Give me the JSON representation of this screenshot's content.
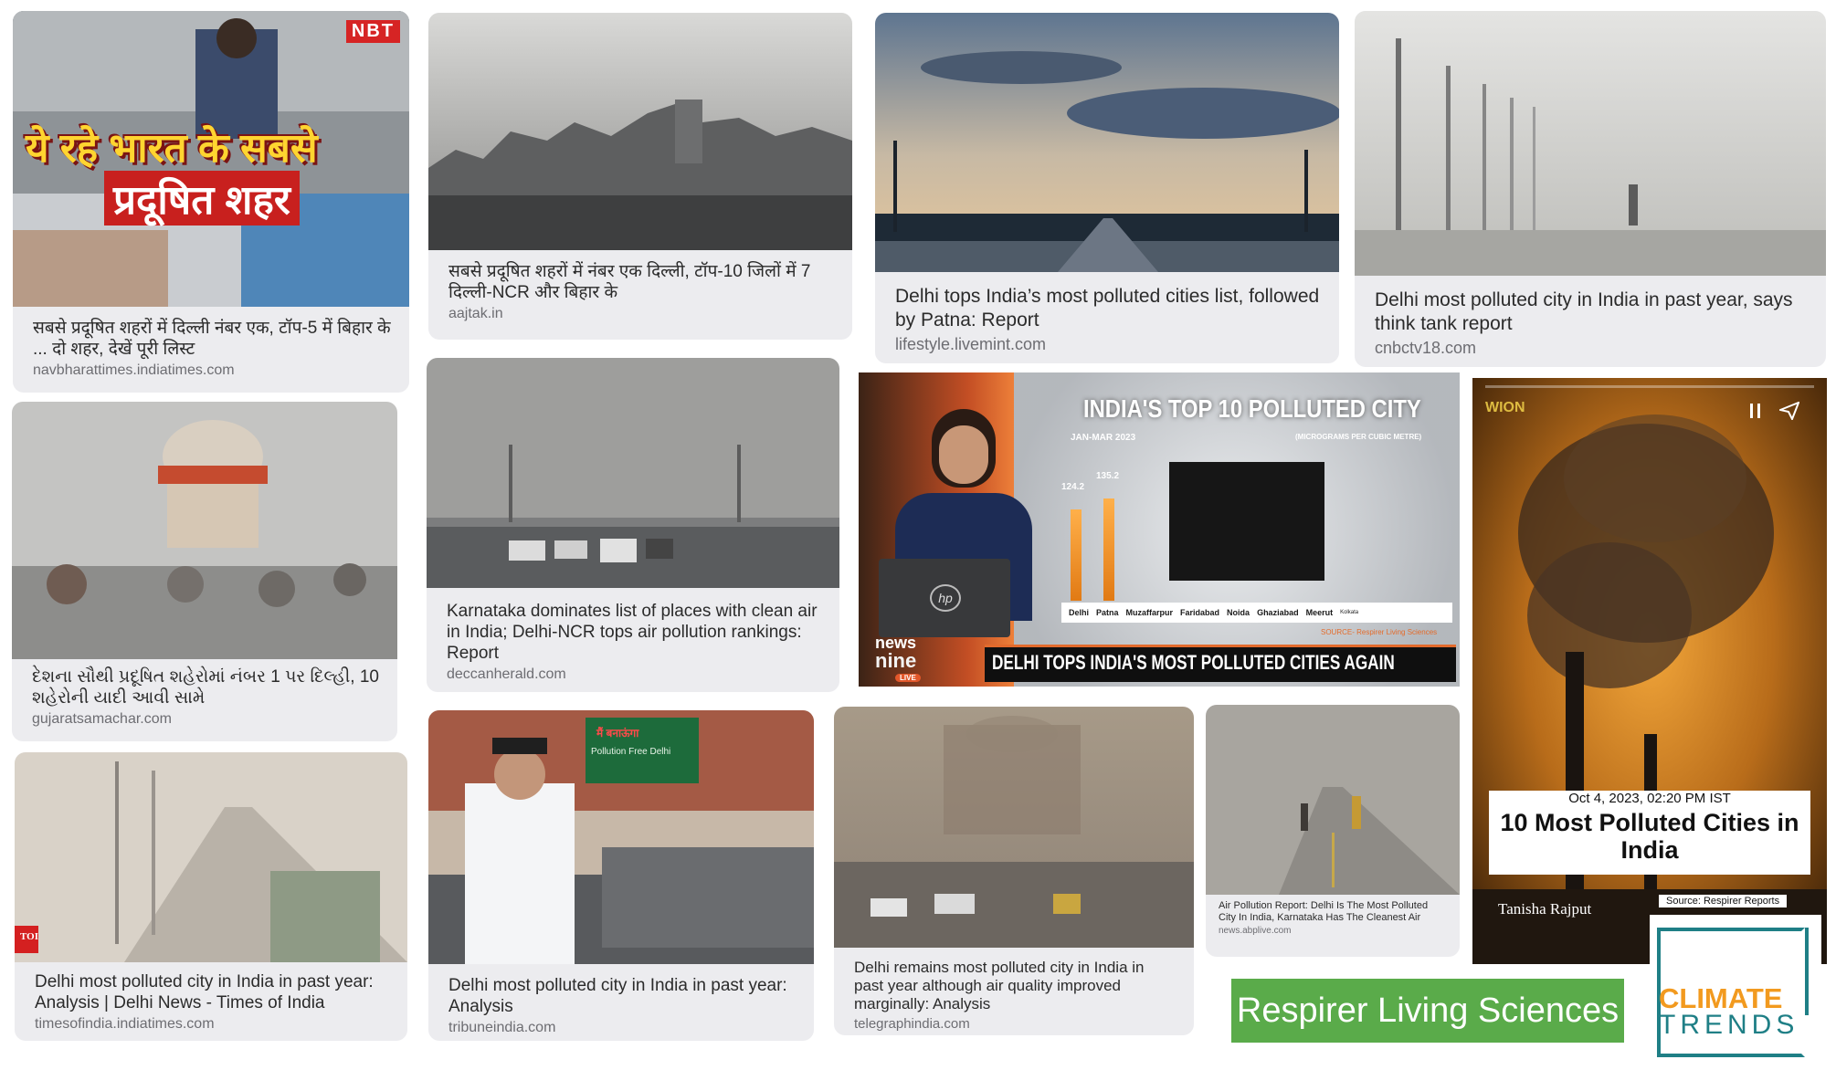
{
  "cards": [
    {
      "title": "सबसे प्रदूषित शहरों में दिल्ली नंबर एक, टॉप-5 में बिहार के ... दो शहर, देखें पूरी लिस्ट",
      "source": "navbharattimes.indiatimes.com",
      "overlay": {
        "badge": "NBT",
        "headline1": "ये रहे भारत के सबसे",
        "headline2": "प्रदूषित शहर"
      }
    },
    {
      "title": "सबसे प्रदूषित शहरों में नंबर एक दिल्ली, टॉप-10 जिलों में 7 दिल्ली-NCR और बिहार के",
      "source": "aajtak.in"
    },
    {
      "title": "Delhi tops India’s most polluted cities list, followed by Patna: Report",
      "source": "lifestyle.livemint.com"
    },
    {
      "title": "Delhi most polluted city in India in past year, says think tank report",
      "source": "cnbctv18.com"
    },
    {
      "title": "દેશના સૌથી પ્રદૂષિત શહેરોમાં નંબર 1 પર દિલ્હી, 10 શહેરોની યાદી આવી સામે",
      "source": "gujaratsamachar.com"
    },
    {
      "title": "Karnataka dominates list of places with clean air in India; Delhi-NCR tops air pollution rankings: Report",
      "source": "deccanherald.com"
    },
    {
      "title": "Delhi most polluted city in India in past year: Analysis | Delhi News - Times of India",
      "source": "timesofindia.indiatimes.com",
      "overlay": {
        "badge": "TOI"
      }
    },
    {
      "title": "Delhi most polluted city in India in past year: Analysis",
      "source": "tribuneindia.com",
      "overlay": {
        "sign1": "मैं बनाऊंगा",
        "sign2": "Pollution Free Delhi"
      }
    },
    {
      "title": "Delhi remains most polluted city in India in past year although air quality improved marginally: Analysis",
      "source": "telegraphindia.com"
    },
    {
      "title": "Air Pollution Report: Delhi Is The Most Polluted City In India, Karnataka Has The Cleanest Air",
      "source": "news.abplive.com"
    }
  ],
  "tv": {
    "headline": "INDIA'S TOP 10 POLLUTED CITY",
    "period": "JAN-MAR 2023",
    "unit": "(MICROGRAMS PER CUBIC METRE)",
    "values": [
      "124.2",
      "135.2"
    ],
    "cities": [
      "Delhi",
      "Patna",
      "Muzaffarpur",
      "Faridabad",
      "Noida",
      "Ghaziabad",
      "Meerut",
      "Kolkata"
    ],
    "source": "SOURCE- Respirer Living Sciences",
    "ticker": "DELHI TOPS INDIA'S MOST POLLUTED CITIES AGAIN",
    "logo1": "news",
    "logo2": "nine",
    "live": "LIVE",
    "laptop_logo": "hp"
  },
  "wion": {
    "logo": "WION",
    "date": "Oct 4, 2023, 02:20 PM IST",
    "headline": "10 Most Polluted Cities in India",
    "author": "Tanisha Rajput",
    "source": "Source: Respirer Reports"
  },
  "respirer": {
    "label": "Respirer Living Sciences",
    "color": "#5aab4a"
  },
  "climate": {
    "line1": "CLIMATE",
    "line2": "TRENDS",
    "orange": "#f29a1f",
    "teal": "#1f7f86"
  }
}
